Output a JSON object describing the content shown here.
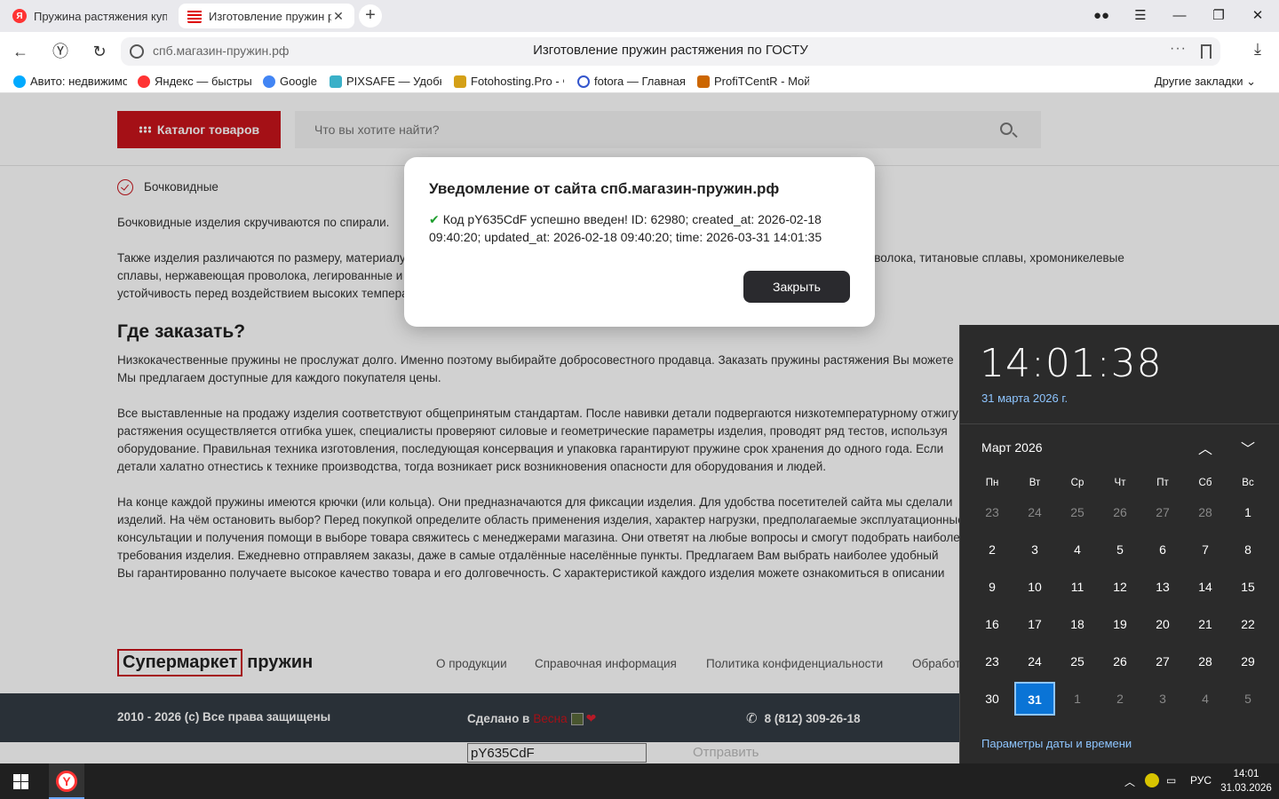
{
  "browser": {
    "tabs": [
      {
        "label": "Пружина растяжения купить",
        "favicon": "yandex-icon"
      },
      {
        "label": "Изготовление пружин растяжения",
        "favicon": "site-icon"
      }
    ],
    "address": "спб.магазин-пружин.рф",
    "page_title": "Изготовление пружин растяжения по ГОСТУ",
    "bookmarks": [
      {
        "label": "Авито: недвижимость",
        "color": "#00aaff"
      },
      {
        "label": "Яндекс — быстрый",
        "color": "#ff3333"
      },
      {
        "label": "Google",
        "color": "#4285f4"
      },
      {
        "label": "PIXSAFE — Удобный",
        "color": "#3ab0c8"
      },
      {
        "label": "Fotohosting.Pro - Ф",
        "color": "#d4a017"
      },
      {
        "label": "fotora — Главная",
        "color": "#3355cc"
      },
      {
        "label": "ProfiTCentR - Мой",
        "color": "#cc6600"
      }
    ],
    "other_bookmarks": "Другие закладки"
  },
  "site": {
    "catalog_label": "Каталог товаров",
    "search_placeholder": "Что вы хотите найти?",
    "bullet_item": "Бочковидные",
    "p1": "Бочковидные изделия скручиваются по спирали.",
    "p2_lines": [
      "Также изделия различаются по размеру, материалу изготовления. Для производства применяются высококачественная пружинная проволока, титановые сплавы, хромоникелевые",
      "сплавы, нержавеющая проволока, легированные и высокоуглеродистые сплавы. Всё это позволяет детали имеют повышенную",
      "устойчивость перед воздействием высоких температур."
    ],
    "heading": "Где заказать?",
    "p3_lines": [
      "Низкокачественные пружины не прослужат долго. Именно поэтому выбирайте добросовестного продавца. Заказать пружины растяжения Вы можете",
      "Мы предлагаем доступные для каждого покупателя цены."
    ],
    "p4_lines": [
      "Все выставленные на продажу изделия соответствуют общепринятым стандартам. После навивки детали подвергаются низкотемпературному отжигу",
      "растяжения осуществляется отгибка ушек, специалисты проверяют силовые и геометрические параметры изделия, проводят ряд тестов, используя",
      "оборудование. Правильная техника изготовления, последующая консервация и упаковка гарантируют пружине срок хранения до одного года. Если",
      "детали халатно отнестись к технике производства, тогда возникает риск возникновения опасности для оборудования и людей."
    ],
    "p5_lines": [
      "На конце каждой пружины имеются крючки (или кольца). Они предназначаются для фиксации изделия. Для удобства посетителей сайта мы сделали",
      "изделий. На чём остановить выбор? Перед покупкой определите область применения изделия, характер нагрузки, предполагаемые эксплуатационные",
      "консультации и получения помощи в выборе товара свяжитесь с менеджерами магазина. Они ответят на любые вопросы и смогут подобрать наиболее",
      "требования изделия. Ежедневно отправляем заказы, даже в самые отдалённые населённые пункты. Предлагаем Вам выбрать наиболее удобный",
      "Вы гарантированно получаете высокое качество товара и его долговечность. С характеристикой каждого изделия можете ознакомиться в описании"
    ],
    "logo_box": "Супермаркет",
    "logo_rest": "пружин",
    "footer_nav": [
      "О продукции",
      "Справочная информация",
      "Политика конфиденциальности",
      "Обработка"
    ],
    "copyright": "2010 - 2026 (c) Все права защищены",
    "made_in": "Сделано в",
    "made_in_brand": "Весна",
    "phone": "8 (812) 309-26-18",
    "code_value": "pY635CdF",
    "submit_label": "Отправить"
  },
  "modal": {
    "title": "Уведомление от сайта спб.магазин-пружин.рф",
    "message": "Код pY635CdF успешно введен! ID: 62980; created_at: 2026-02-18 09:40:20; updated_at: 2026-02-18 09:40:20; time: 2026-03-31 14:01:35",
    "close_label": "Закрыть"
  },
  "clock": {
    "time": "14:01:38",
    "date": "31 марта 2026 г.",
    "month": "Март 2026",
    "weekdays": [
      "Пн",
      "Вт",
      "Ср",
      "Чт",
      "Пт",
      "Сб",
      "Вс"
    ],
    "weeks": [
      [
        {
          "d": "23",
          "dim": true
        },
        {
          "d": "24",
          "dim": true
        },
        {
          "d": "25",
          "dim": true
        },
        {
          "d": "26",
          "dim": true
        },
        {
          "d": "27",
          "dim": true
        },
        {
          "d": "28",
          "dim": true
        },
        {
          "d": "1"
        }
      ],
      [
        {
          "d": "2"
        },
        {
          "d": "3"
        },
        {
          "d": "4"
        },
        {
          "d": "5"
        },
        {
          "d": "6"
        },
        {
          "d": "7"
        },
        {
          "d": "8"
        }
      ],
      [
        {
          "d": "9"
        },
        {
          "d": "10"
        },
        {
          "d": "11"
        },
        {
          "d": "12"
        },
        {
          "d": "13"
        },
        {
          "d": "14"
        },
        {
          "d": "15"
        }
      ],
      [
        {
          "d": "16"
        },
        {
          "d": "17"
        },
        {
          "d": "18"
        },
        {
          "d": "19"
        },
        {
          "d": "20"
        },
        {
          "d": "21"
        },
        {
          "d": "22"
        }
      ],
      [
        {
          "d": "23"
        },
        {
          "d": "24"
        },
        {
          "d": "25"
        },
        {
          "d": "26"
        },
        {
          "d": "27"
        },
        {
          "d": "28"
        },
        {
          "d": "29"
        }
      ],
      [
        {
          "d": "30"
        },
        {
          "d": "31",
          "today": true
        },
        {
          "d": "1",
          "dim": true
        },
        {
          "d": "2",
          "dim": true
        },
        {
          "d": "3",
          "dim": true
        },
        {
          "d": "4",
          "dim": true
        },
        {
          "d": "5",
          "dim": true
        }
      ]
    ],
    "settings_link": "Параметры даты и времени"
  },
  "taskbar": {
    "language": "РУС",
    "time": "14:01",
    "date": "31.03.2026"
  }
}
